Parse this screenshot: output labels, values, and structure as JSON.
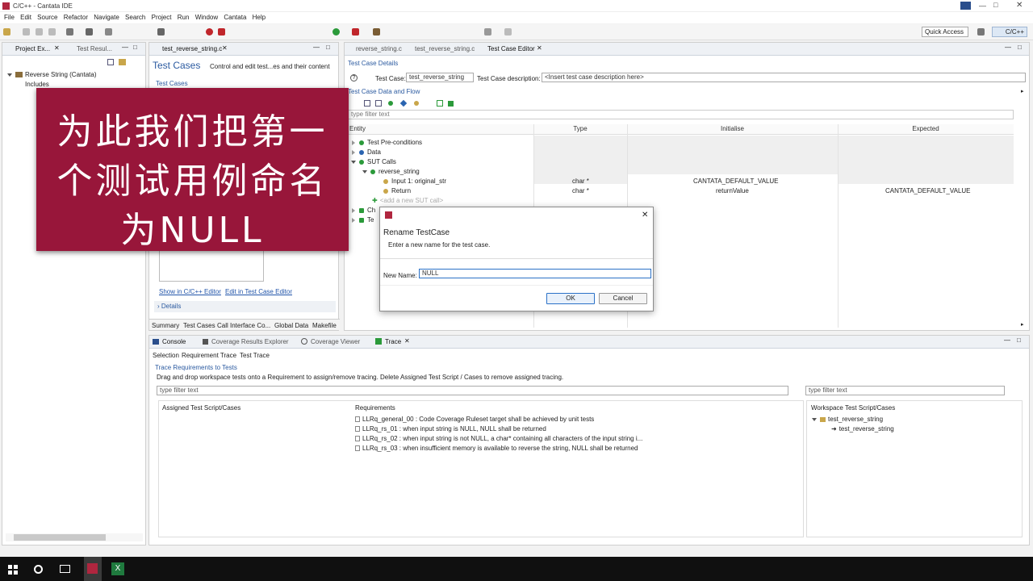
{
  "window": {
    "title": "C/C++ - Cantata IDE"
  },
  "menu": [
    "File",
    "Edit",
    "Source",
    "Refactor",
    "Navigate",
    "Search",
    "Project",
    "Run",
    "Window",
    "Cantata",
    "Help"
  ],
  "toolbar": {
    "quick_access": "Quick Access",
    "perspective": "C/C++"
  },
  "left_tabs": {
    "project_explorer": "Project Ex...",
    "test_results": "Test Resul..."
  },
  "project_tree": {
    "root": "Reverse String (Cantata)",
    "includes": "Includes"
  },
  "middle": {
    "tab": "test_reverse_string.c",
    "header_title": "Test Cases",
    "header_desc": "Control and edit test...es and their content",
    "section": "Test Cases",
    "show_link": "Show in C/C++ Editor",
    "edit_link": "Edit in Test Case Editor",
    "details": "Details",
    "bottom_tabs": [
      "Summary",
      "Test Cases",
      "Call Interface Co...",
      "Global Data",
      "Makefile"
    ]
  },
  "editor": {
    "tabs": [
      "reverse_string.c",
      "test_reverse_string.c",
      "Test Case Editor"
    ],
    "details_title": "Test Case Details",
    "test_case_label": "Test Case:",
    "test_case_value": "test_reverse_string",
    "desc_label": "Test Case description:",
    "desc_value": "<Insert test case description here>",
    "data_flow_title": "Test Case Data and Flow",
    "filter_placeholder": "type filter text",
    "columns": [
      "Entity",
      "Type",
      "Initialise",
      "Expected"
    ],
    "rows": [
      {
        "entity": "Test Pre-conditions",
        "type": "",
        "init": "",
        "expected": "",
        "level": 1
      },
      {
        "entity": "Data",
        "type": "",
        "init": "",
        "expected": "",
        "level": 1
      },
      {
        "entity": "SUT Calls",
        "type": "",
        "init": "",
        "expected": "",
        "level": 1
      },
      {
        "entity": "reverse_string",
        "type": "",
        "init": "",
        "expected": "",
        "level": 2
      },
      {
        "entity": "Input 1: original_str",
        "type": "char *",
        "init": "CANTATA_DEFAULT_VALUE",
        "expected": "",
        "level": 3
      },
      {
        "entity": "Return",
        "type": "char *",
        "init": "returnValue",
        "expected": "CANTATA_DEFAULT_VALUE",
        "level": 3
      },
      {
        "entity": "<add a new SUT call>",
        "type": "",
        "init": "",
        "expected": "",
        "level": 2
      },
      {
        "entity": "Ch",
        "type": "",
        "init": "",
        "expected": "",
        "level": 1
      },
      {
        "entity": "Te",
        "type": "",
        "init": "",
        "expected": "",
        "level": 1
      }
    ]
  },
  "dialog": {
    "title": "Rename TestCase",
    "subtitle": "Enter a new name for the test case.",
    "name_label": "New Name:",
    "name_value": "NULL",
    "ok": "OK",
    "cancel": "Cancel"
  },
  "overlay": {
    "line1": "为此我们把第一",
    "line2": "个测试用例命名",
    "line3": "为NULL"
  },
  "bottom": {
    "tabs": [
      "Console",
      "Coverage Results Explorer",
      "Coverage Viewer",
      "Trace"
    ],
    "subtabs": [
      "Selection",
      "Requirement Trace",
      "Test Trace"
    ],
    "section_title": "Trace Requirements to Tests",
    "instructions": "Drag and drop workspace tests onto a Requirement to assign/remove tracing. Delete Assigned Test Script / Cases to remove assigned tracing.",
    "filter_left": "type filter text",
    "filter_right": "type filter text",
    "assigned_header": "Assigned Test Script/Cases",
    "requirements_header": "Requirements",
    "requirements": [
      "LLRq_general_00 : Code Coverage Ruleset target shall be achieved by unit tests",
      "LLRq_rs_01 : when input string is NULL,  NULL shall be returned",
      "LLRq_rs_02 : when input string is not NULL,  a char* containing all characters of the input string i...",
      "LLRq_rs_03 : when insufficient memory is available to reverse the string, NULL shall be returned"
    ],
    "workspace_header": "Workspace Test Script/Cases",
    "workspace_items": [
      "test_reverse_string",
      "test_reverse_string"
    ]
  },
  "colors": {
    "overlay": "#98163a",
    "accent": "#2c72c7",
    "taskbar": "#101010"
  }
}
